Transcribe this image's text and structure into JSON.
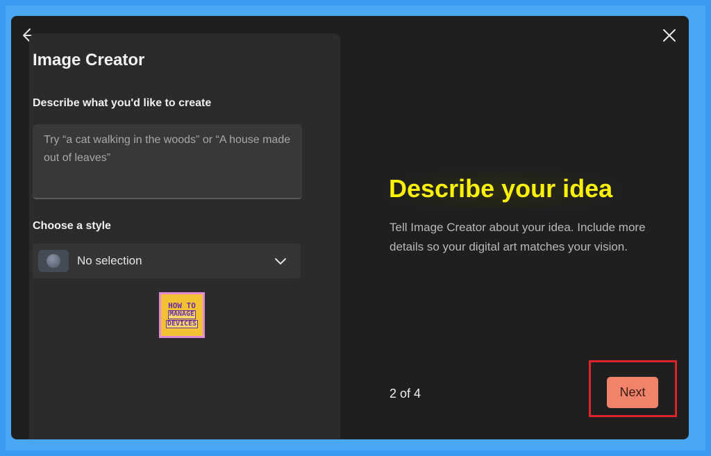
{
  "colors": {
    "backdrop": "#3a9cf0",
    "dialog_bg": "#1f1f1f",
    "panel_bg": "#2b2b2b",
    "headline": "#fff200",
    "next_button": "#f0836a",
    "highlight_border": "#e0222a"
  },
  "icons": {
    "back": "arrow-left-icon",
    "close": "close-icon",
    "dropdown": "chevron-down-icon",
    "style_thumbnail": "style-thumbnail-icon"
  },
  "panel": {
    "title": "Image Creator",
    "describe_label": "Describe what you'd like to create",
    "prompt_placeholder": "Try “a cat walking in the woods” or “A house made out of leaves”",
    "style_label": "Choose a style",
    "style_value": "No selection"
  },
  "logo": {
    "line1": "HOW TO",
    "line2": "MANAGE",
    "line3": "DEVICES"
  },
  "onboarding": {
    "headline": "Describe your idea",
    "description": "Tell Image Creator about your idea. Include more details so your digital art matches your vision.",
    "page_indicator": "2 of 4",
    "next_label": "Next"
  }
}
